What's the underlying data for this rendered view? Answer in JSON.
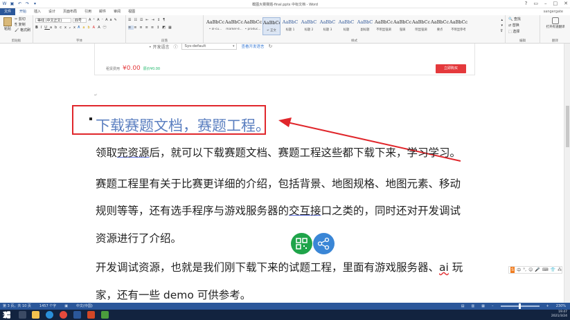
{
  "window": {
    "title": "截图大赛赛题-final.pptx 中标文档 - Word"
  },
  "tabs": {
    "file": "文件",
    "items": [
      "开始",
      "插入",
      "设计",
      "页面布局",
      "引用",
      "邮件",
      "审阅",
      "视图"
    ],
    "active_index": 0,
    "account": "sangergate"
  },
  "ribbon": {
    "clipboard": {
      "paste": "粘贴",
      "cut": "剪切",
      "copy": "复制",
      "format_painter": "格式刷",
      "label": "剪贴板"
    },
    "font": {
      "name": "等线 (中文正文)",
      "size": "四号",
      "label": "字体"
    },
    "paragraph": {
      "label": "段落"
    },
    "styles": {
      "label": "样式",
      "items": [
        {
          "sample": "AaBbCcDd",
          "name": "• ol-cu..."
        },
        {
          "sample": "AaBbCcDd",
          "name": "marker-d..."
        },
        {
          "sample": "AaBbCcDd",
          "name": "• produc..."
        },
        {
          "sample": "AaBbCcDd",
          "name": "↵ 正文"
        },
        {
          "sample": "AaBbC",
          "name": "标题 1"
        },
        {
          "sample": "AaBbC",
          "name": "标题 2"
        },
        {
          "sample": "AaBbC",
          "name": "标题 3"
        },
        {
          "sample": "AaBbC",
          "name": "标题"
        },
        {
          "sample": "AaBbC",
          "name": "副标题"
        },
        {
          "sample": "AaBbCcDd",
          "name": "不明显强调"
        },
        {
          "sample": "AaBbCcDd",
          "name": "强调"
        },
        {
          "sample": "AaBbCcDd",
          "name": "明显强调"
        },
        {
          "sample": "AaBbCcDd",
          "name": "要点"
        },
        {
          "sample": "AaBbCcDd",
          "name": "不明显参考"
        }
      ],
      "selected_index": 3
    },
    "editing": {
      "find": "查找",
      "replace": "替换",
      "select": "选择",
      "label": "编辑"
    },
    "share": {
      "button": "打开有道翻译",
      "label": "翻译"
    }
  },
  "embedded_page": {
    "sdk_label": "• 开发语言",
    "sdk_value": "Sys-default",
    "link": "查看开发语言",
    "price_label": "租赁费用",
    "price": "¥0.00",
    "price_sub": "原价¥0.00",
    "buy_button": "立即购买"
  },
  "document": {
    "heading": "下载赛题文档，赛题工程。",
    "paragraphs": [
      [
        "领取",
        "完资源",
        "后，就可以下载赛题文档、赛题工程这些都下载下来，学习学习。"
      ],
      [
        "赛题工程里有关于比赛更详细的介绍，包括背景、地图规格、地图元素、移动"
      ],
      [
        "规则等等，还有选手程序与游戏服务器的",
        "交互接",
        "口之类的，同时还对开发调试"
      ],
      [
        "资源进行了介绍。"
      ],
      [
        "开发调试资源，也就是我们刚下载下来的试题工程，里面有游戏服务器、",
        "ai",
        " 玩"
      ],
      [
        "家，还有一些 demo 可供参考。"
      ]
    ]
  },
  "ime": {
    "logo": "S",
    "label": "中"
  },
  "status": {
    "page": "第 3 页，共 10 页",
    "words": "1457 个字",
    "language": "中文(中国)",
    "zoom": "230%"
  },
  "tray": {
    "time": "19:47",
    "date": "2021/3/24"
  },
  "colors": {
    "accent": "#2b579a",
    "highlight_box": "#e0262b",
    "heading": "#5b7fc0",
    "qr": "#1fa44a",
    "share": "#3a86d6"
  }
}
